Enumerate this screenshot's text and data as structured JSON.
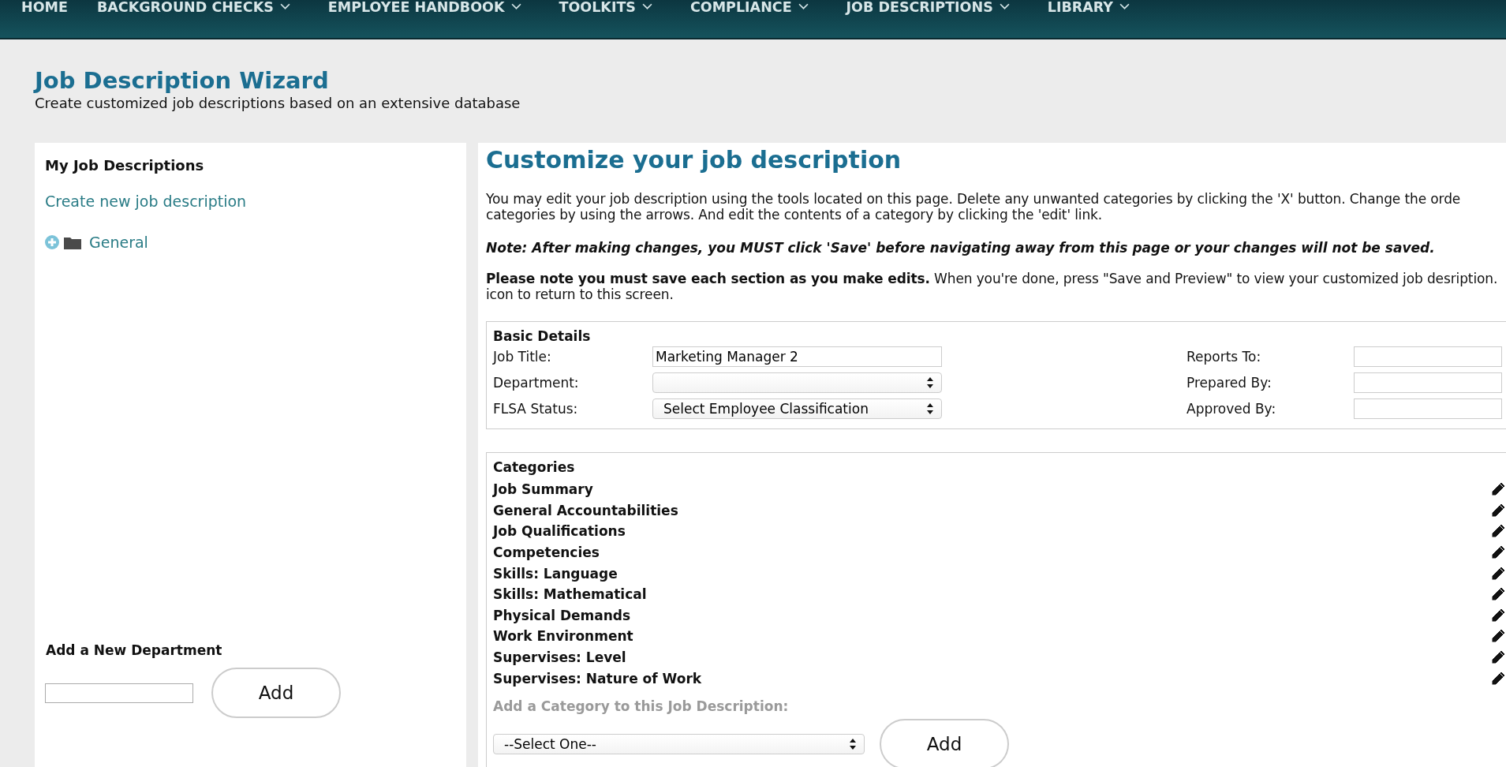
{
  "nav": {
    "items": [
      {
        "label": "HOME",
        "dropdown": false
      },
      {
        "label": "BACKGROUND CHECKS",
        "dropdown": true
      },
      {
        "label": "EMPLOYEE HANDBOOK",
        "dropdown": true
      },
      {
        "label": "TOOLKITS",
        "dropdown": true
      },
      {
        "label": "COMPLIANCE",
        "dropdown": true
      },
      {
        "label": "JOB DESCRIPTIONS",
        "dropdown": true
      },
      {
        "label": "LIBRARY",
        "dropdown": true
      }
    ]
  },
  "page": {
    "title": "Job Description Wizard",
    "subtitle": "Create customized job descriptions based on an extensive database"
  },
  "sidebar": {
    "title": "My Job Descriptions",
    "create_link": "Create new job description",
    "folders": [
      {
        "label": "General",
        "expanded": false
      }
    ],
    "add_department": {
      "label": "Add a New Department",
      "button": "Add"
    }
  },
  "main": {
    "title": "Customize your job description",
    "intro_lines": [
      "You may edit your job description using the tools located on this page. Delete any unwanted categories by clicking the 'X' button.  Change the orde",
      "categories by using the arrows.   And edit the contents of a category by clicking the 'edit' link."
    ],
    "note": "Note: After making changes, you MUST click 'Save' before navigating away from this page or your changes will not be saved.",
    "instruction_lines": [
      "**Please note you must save each section as you make edits.** When you're done, press \"Save and Preview\" to view your customized job desription.",
      "icon to return to this screen."
    ],
    "basic_details": {
      "title": "Basic Details",
      "left_fields": [
        {
          "label": "Job Title:",
          "kind": "text",
          "value": "Marketing Manager 2"
        },
        {
          "label": "Department:",
          "kind": "select"
        },
        {
          "label": "FLSA Status:",
          "kind": "select",
          "value": "Select Employee Classification"
        }
      ],
      "right_fields": [
        {
          "label": "Reports To:"
        },
        {
          "label": "Prepared By:"
        },
        {
          "label": "Approved By:"
        }
      ]
    },
    "categories": {
      "title": "Categories",
      "items": [
        "Job Summary",
        "General Accountabilities",
        "Job Qualifications",
        "Competencies",
        "Skills: Language",
        "Skills: Mathematical",
        "Physical Demands",
        "Work Environment",
        "Supervises: Level",
        "Supervises: Nature of Work"
      ],
      "add_label": "Add a Category to this Job Description:",
      "select_value": "--Select One--",
      "button": "Add"
    }
  }
}
